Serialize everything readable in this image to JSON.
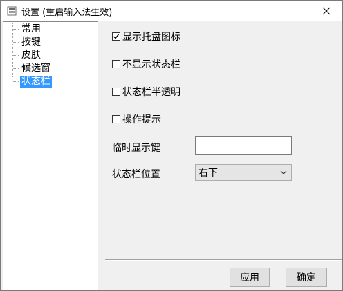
{
  "window": {
    "title": "设置 (重启输入法生效)"
  },
  "tree": {
    "items": [
      {
        "label": "常用"
      },
      {
        "label": "按键"
      },
      {
        "label": "皮肤"
      },
      {
        "label": "候选窗"
      },
      {
        "label": "状态栏",
        "selected": true
      }
    ]
  },
  "options": {
    "show_tray_icon": {
      "label": "显示托盘图标",
      "checked": true
    },
    "hide_status_bar": {
      "label": "不显示状态栏",
      "checked": false
    },
    "status_bar_translucent": {
      "label": "状态栏半透明",
      "checked": false
    },
    "operation_tips": {
      "label": "操作提示",
      "checked": false
    }
  },
  "temp_display_key": {
    "label": "临时显示键",
    "value": ""
  },
  "status_bar_position": {
    "label": "状态栏位置",
    "selected": "右下"
  },
  "buttons": {
    "apply": "应用",
    "ok": "确定"
  },
  "colors": {
    "selection": "#3399ff",
    "window_bg": "#f0f0f0"
  }
}
